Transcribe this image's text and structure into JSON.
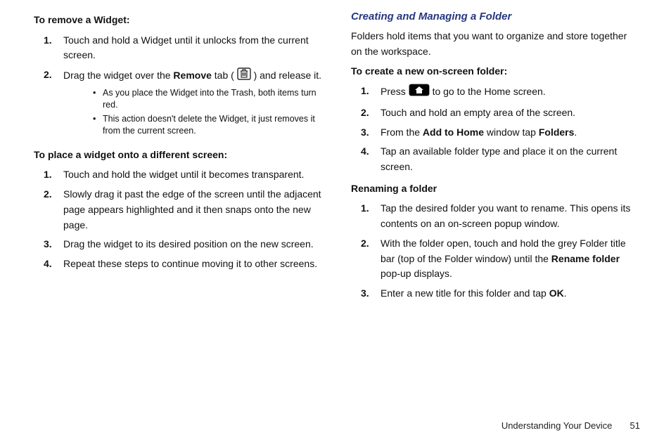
{
  "left": {
    "removeHead": "To remove a Widget:",
    "removeSteps": [
      {
        "text": "Touch and hold a Widget until it unlocks from the current screen."
      },
      {
        "pre": "Drag the widget over the ",
        "bold": "Remove",
        "mid": " tab ( ",
        "post": " ) and release it."
      }
    ],
    "removeNotes": [
      "As you place the Widget into the Trash, both items turn red.",
      "This action doesn't delete the Widget, it just removes it from the current screen."
    ],
    "placeHead": "To place a widget onto a different screen:",
    "placeSteps": [
      "Touch and hold the widget until it becomes transparent.",
      "Slowly drag it past the edge of the screen until the adjacent page appears highlighted and it then snaps onto the new page.",
      "Drag the widget to its desired position on the new screen.",
      "Repeat these steps to continue moving it to other screens."
    ]
  },
  "right": {
    "sectionTitle": "Creating and Managing a Folder",
    "intro": "Folders hold items that you want to organize and store together on the workspace.",
    "createHead": "To create a new on-screen folder:",
    "createSteps": {
      "s1pre": "Press ",
      "s1post": " to go to the Home screen.",
      "s2": "Touch and hold an empty area of the screen.",
      "s3pre": "From the ",
      "s3b1": "Add to Home",
      "s3mid": " window tap ",
      "s3b2": "Folders",
      "s3post": ".",
      "s4": "Tap an available folder type and place it on the current screen."
    },
    "renameHead": "Renaming a folder",
    "renameSteps": {
      "s1": "Tap the desired folder you want to rename. This opens its contents on an on-screen popup window.",
      "s2pre": "With the folder open, touch and hold the grey Folder title bar (top of the Folder window) until the ",
      "s2b": "Rename folder",
      "s2post": " pop-up displays.",
      "s3pre": "Enter a new title for this folder and tap ",
      "s3b": "OK",
      "s3post": "."
    }
  },
  "footer": {
    "section": "Understanding Your Device",
    "page": "51"
  }
}
